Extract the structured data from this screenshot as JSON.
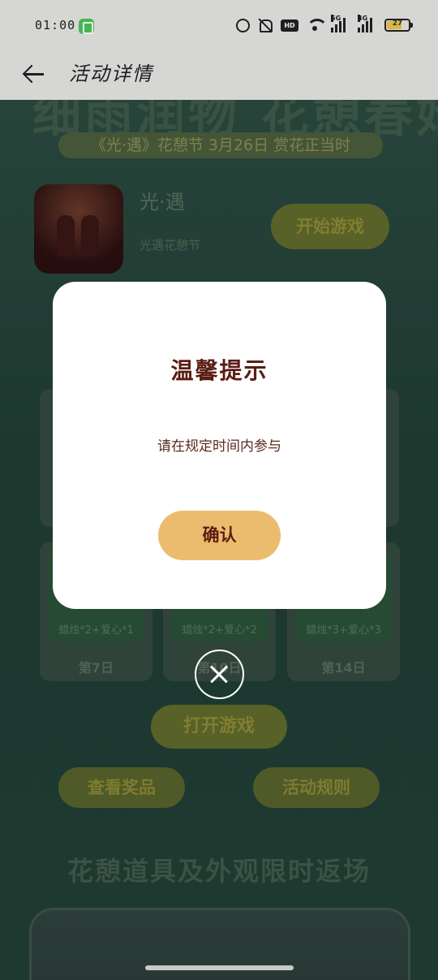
{
  "status_bar": {
    "time": "01:00",
    "network_hd": "HD",
    "signal_1": "5G",
    "signal_2": "4G",
    "battery_level": "27"
  },
  "header": {
    "title": "活动详情"
  },
  "background_page": {
    "banner_title": "细雨润物 花憩春始",
    "banner_subtitle": "《光·遇》花憩节 3月26日 赏花正当时",
    "game": {
      "name": "光·遇",
      "subtitle": "光遇花憩节",
      "start_button": "开始游戏"
    },
    "reward_cards": [
      {
        "reward": "蜡烛*2+爱心*1",
        "day": "第7日"
      },
      {
        "reward": "蜡烛*2+爱心*2",
        "day": "第10日"
      },
      {
        "reward": "蜡烛*3+爱心*3",
        "day": "第14日"
      }
    ],
    "open_game_button": "打开游戏",
    "view_prizes_button": "查看奖品",
    "rules_button": "活动规则",
    "section_title": "花憩道具及外观限时返场"
  },
  "dialog": {
    "title": "温馨提示",
    "message": "请在规定时间内参与",
    "confirm_button": "确认"
  },
  "icons": {
    "back": "arrow-left-icon",
    "close": "close-circle-icon"
  }
}
